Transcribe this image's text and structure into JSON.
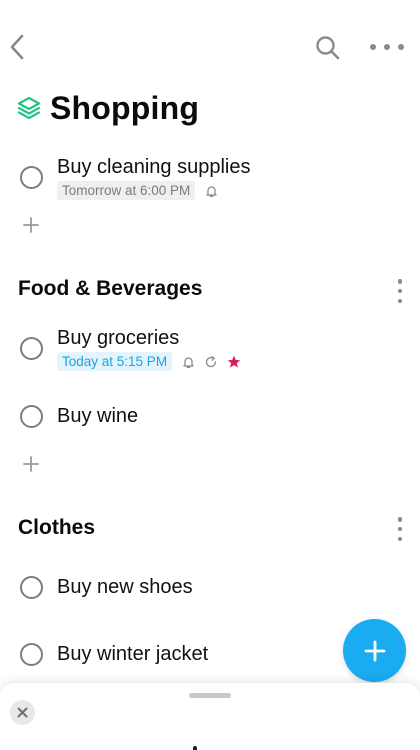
{
  "header": {
    "back_icon": "chevron-left-icon",
    "search_icon": "search-icon",
    "more_icon": "more-horizontal-icon",
    "list_icon": "stack-layers-icon",
    "title": "Shopping"
  },
  "colors": {
    "accent": "#1aabf0",
    "list_icon": "#23c483",
    "due_today": "#1aa3e0",
    "due_tomorrow": "#7b7b7b",
    "star": "#d81b60"
  },
  "tasks": [
    {
      "title": "Buy cleaning supplies",
      "due": "Tomorrow at 6:00 PM",
      "icons": [
        "bell-icon"
      ]
    }
  ],
  "sections": [
    {
      "title": "Food & Beverages",
      "tasks": [
        {
          "title": "Buy groceries",
          "due": "Today at 5:15 PM",
          "icons": [
            "bell-icon",
            "repeat-icon",
            "star-icon"
          ]
        },
        {
          "title": "Buy wine"
        }
      ]
    },
    {
      "title": "Clothes",
      "tasks": [
        {
          "title": "Buy new shoes"
        },
        {
          "title": "Buy winter jacket"
        }
      ]
    }
  ],
  "fab_icon": "plus-icon",
  "sheet": {
    "close_icon": "close-icon"
  }
}
